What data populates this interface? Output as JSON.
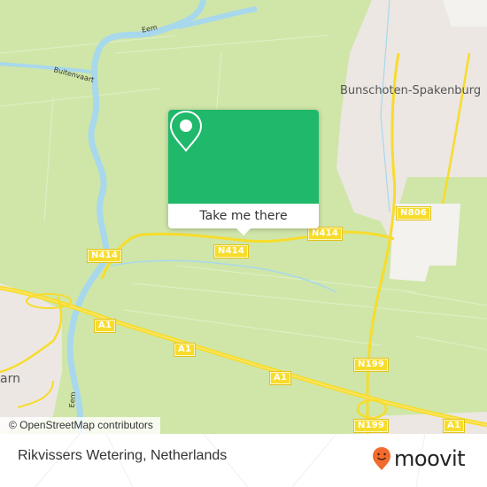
{
  "map": {
    "colors": {
      "land": "#cfe6a8",
      "urban": "#ece7e3",
      "industrial": "#f3f2ee",
      "water": "#a8d8ec",
      "road_major": "#f7dc2b",
      "popup_green": "#20b86a",
      "moovit_orange": "#f26b2e"
    },
    "place_labels": {
      "bunschoten": "Bunschoten-Spakenburg",
      "amersfoort_partial": "arn"
    },
    "water_labels": {
      "eem_top": "Eem",
      "buitenvaart": "Buitenvaart",
      "eem_bottom": "Eem"
    },
    "road_shields": {
      "n414_left": "N414",
      "n414_center": "N414",
      "n414_right": "N414",
      "n806": "N806",
      "a1_left": "A1",
      "a1_mid": "A1",
      "a1_center": "A1",
      "a1_right": "A1",
      "n199_top": "N199",
      "n199_bottom": "N199"
    },
    "attribution": "© OpenStreetMap contributors"
  },
  "popup": {
    "icon": "location-pin-icon",
    "cta_label": "Take me there"
  },
  "footer": {
    "location_title": "Rikvissers Wetering, Netherlands",
    "brand": "moovit",
    "brand_icon": "moovit-smiley-pin-icon"
  }
}
